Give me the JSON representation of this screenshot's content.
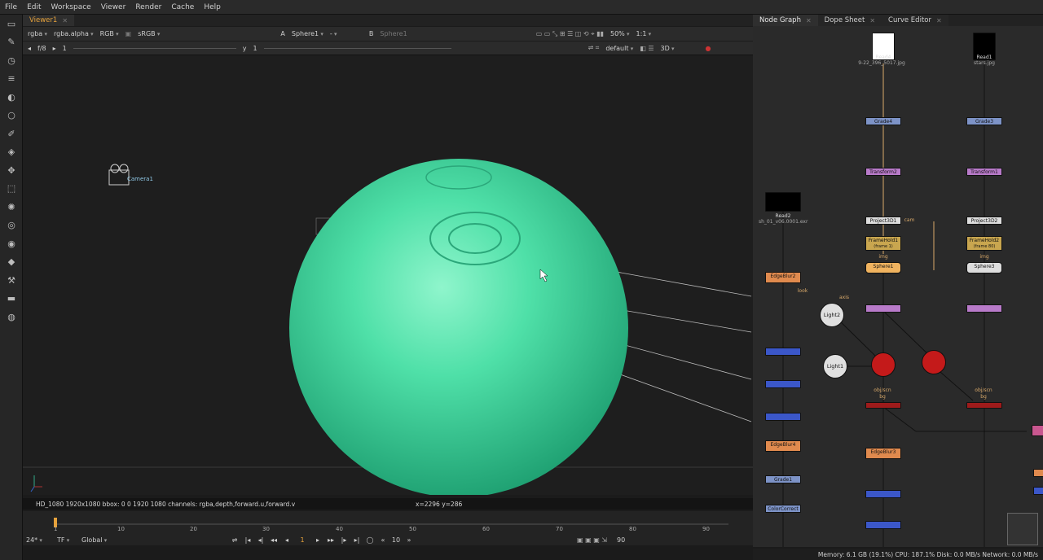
{
  "menu": [
    "File",
    "Edit",
    "Workspace",
    "Viewer",
    "Render",
    "Cache",
    "Help"
  ],
  "viewer": {
    "tab": "Viewer1",
    "channel": "rgba",
    "alpha": "rgba.alpha",
    "color_mode": "RGB",
    "lut": "sRGB",
    "input_a_label": "A",
    "input_a": "Sphere1",
    "input_a_dash": "-",
    "input_b_label": "B",
    "input_b": "Sphere1",
    "zoom": "50%",
    "ratio": "1:1",
    "fstop": "f/8",
    "gain_val": "1",
    "y_label": "y",
    "y_val": "1",
    "camera_default": "default",
    "mode": "3D",
    "camera_label": "Camera1"
  },
  "status": {
    "format": "HD_1080 1920x1080  bbox: 0 0 1920 1080 channels: rgba,depth,forward.u,forward.v",
    "coords": "x=2296 y=286"
  },
  "timeline": {
    "ticks": [
      "1",
      "10",
      "20",
      "30",
      "40",
      "50",
      "60",
      "70",
      "80",
      "90"
    ],
    "fps": "24*",
    "tf": "TF",
    "scope": "Global",
    "frame": "1",
    "step": "10",
    "end": "90"
  },
  "nodegraph": {
    "tabs": [
      "Node Graph",
      "Dope Sheet",
      "Curve Editor"
    ],
    "nodes": {
      "read4": "Read4",
      "read4_sub": "9-22_396_5017.jpg",
      "read1": "Read1",
      "read1_sub": "stars.jpg",
      "grade4": "Grade4",
      "grade3": "Grade3",
      "transform2": "Transform2",
      "transform1": "Transform1",
      "read2": "Read2",
      "read2_sub": "sh_01_v06.0001.exr",
      "project3d1": "Project3D1",
      "project3d2": "Project3D2",
      "cam": "cam",
      "framehold1": "FrameHold1",
      "framehold1_sub": "(frame 1)",
      "framehold2": "FrameHold2",
      "framehold2_sub": "(frame 80)",
      "img": "img",
      "sphere1": "Sphere1",
      "sphere3": "Sphere3",
      "edgeblur2": "EdgeBlur2",
      "edgeblur4": "EdgeBlur4",
      "edgeblur3": "EdgeBlur3",
      "light2": "Light2",
      "light1": "Light1",
      "look": "look",
      "axis": "axis",
      "grade1": "Grade1",
      "colorcorrect": "ColorCorrect",
      "obj_scn": "obj/scn",
      "bg": "bg"
    }
  },
  "memory": "Memory: 6.1 GB (19.1%)  CPU: 187.1%  Disk: 0.0 MB/s  Network: 0.0 MB/s",
  "colors": {
    "accent": "#e6a23c",
    "sphere": "#3fd9a0",
    "node_grade": "#7d93c7",
    "node_transform": "#b87ac9",
    "node_blur": "#e08a4e",
    "node_red": "#c41a1a"
  }
}
